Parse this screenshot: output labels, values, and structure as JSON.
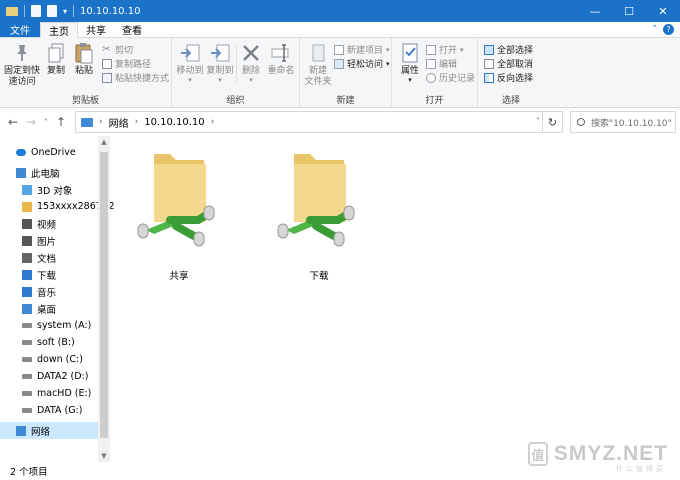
{
  "window": {
    "title": "10.10.10.10",
    "controls": {
      "minimize": "—",
      "maximize": "☐",
      "close": "✕"
    }
  },
  "tabs": [
    "文件",
    "主页",
    "共享",
    "查看"
  ],
  "ribbon": {
    "clipboard": {
      "label": "剪贴板",
      "pin": "固定到快\n速访问",
      "copy": "复制",
      "paste": "粘贴",
      "cut": "剪切",
      "copy_path": "复制路径",
      "paste_shortcut": "粘贴快捷方式"
    },
    "organize": {
      "label": "组织",
      "move_to": "移动到",
      "copy_to": "复制到",
      "delete": "删除",
      "rename": "重命名"
    },
    "new": {
      "label": "新建",
      "new_folder": "新建\n文件夹",
      "new_item": "新建项目",
      "easy_access": "轻松访问"
    },
    "open": {
      "label": "打开",
      "properties": "属性",
      "open": "打开",
      "edit": "编辑",
      "history": "历史记录"
    },
    "select": {
      "label": "选择",
      "select_all": "全部选择",
      "select_none": "全部取消",
      "invert": "反向选择"
    }
  },
  "address": {
    "crumbs": [
      "网络",
      "10.10.10.10"
    ],
    "search_placeholder": "搜索\"10.10.10.10\""
  },
  "nav": [
    {
      "label": "OneDrive",
      "icon": "cloud-icon"
    },
    {
      "label": "此电脑",
      "icon": "computer-icon"
    },
    {
      "label": "3D 对象",
      "icon": "3d-objects-icon"
    },
    {
      "label": "153xxxx2867 (2",
      "icon": "user-folder-icon"
    },
    {
      "label": "视频",
      "icon": "video-icon"
    },
    {
      "label": "图片",
      "icon": "pictures-icon"
    },
    {
      "label": "文档",
      "icon": "documents-icon"
    },
    {
      "label": "下载",
      "icon": "download-icon"
    },
    {
      "label": "音乐",
      "icon": "music-icon"
    },
    {
      "label": "桌面",
      "icon": "desktop-icon"
    },
    {
      "label": "system (A:)",
      "icon": "drive-icon"
    },
    {
      "label": "soft (B:)",
      "icon": "drive-icon"
    },
    {
      "label": "down (C:)",
      "icon": "drive-icon"
    },
    {
      "label": "DATA2 (D:)",
      "icon": "drive-icon"
    },
    {
      "label": "macHD (E:)",
      "icon": "drive-icon"
    },
    {
      "label": "DATA (G:)",
      "icon": "drive-icon"
    },
    {
      "label": "网络",
      "icon": "network-icon"
    }
  ],
  "items": [
    {
      "label": "共享",
      "icon": "network-share-folder-icon"
    },
    {
      "label": "下载",
      "icon": "network-share-folder-icon"
    }
  ],
  "status": {
    "count": "2 个项目"
  },
  "watermark": {
    "badge": "值",
    "text": "SMYZ.NET",
    "sub": "什么值得买"
  }
}
